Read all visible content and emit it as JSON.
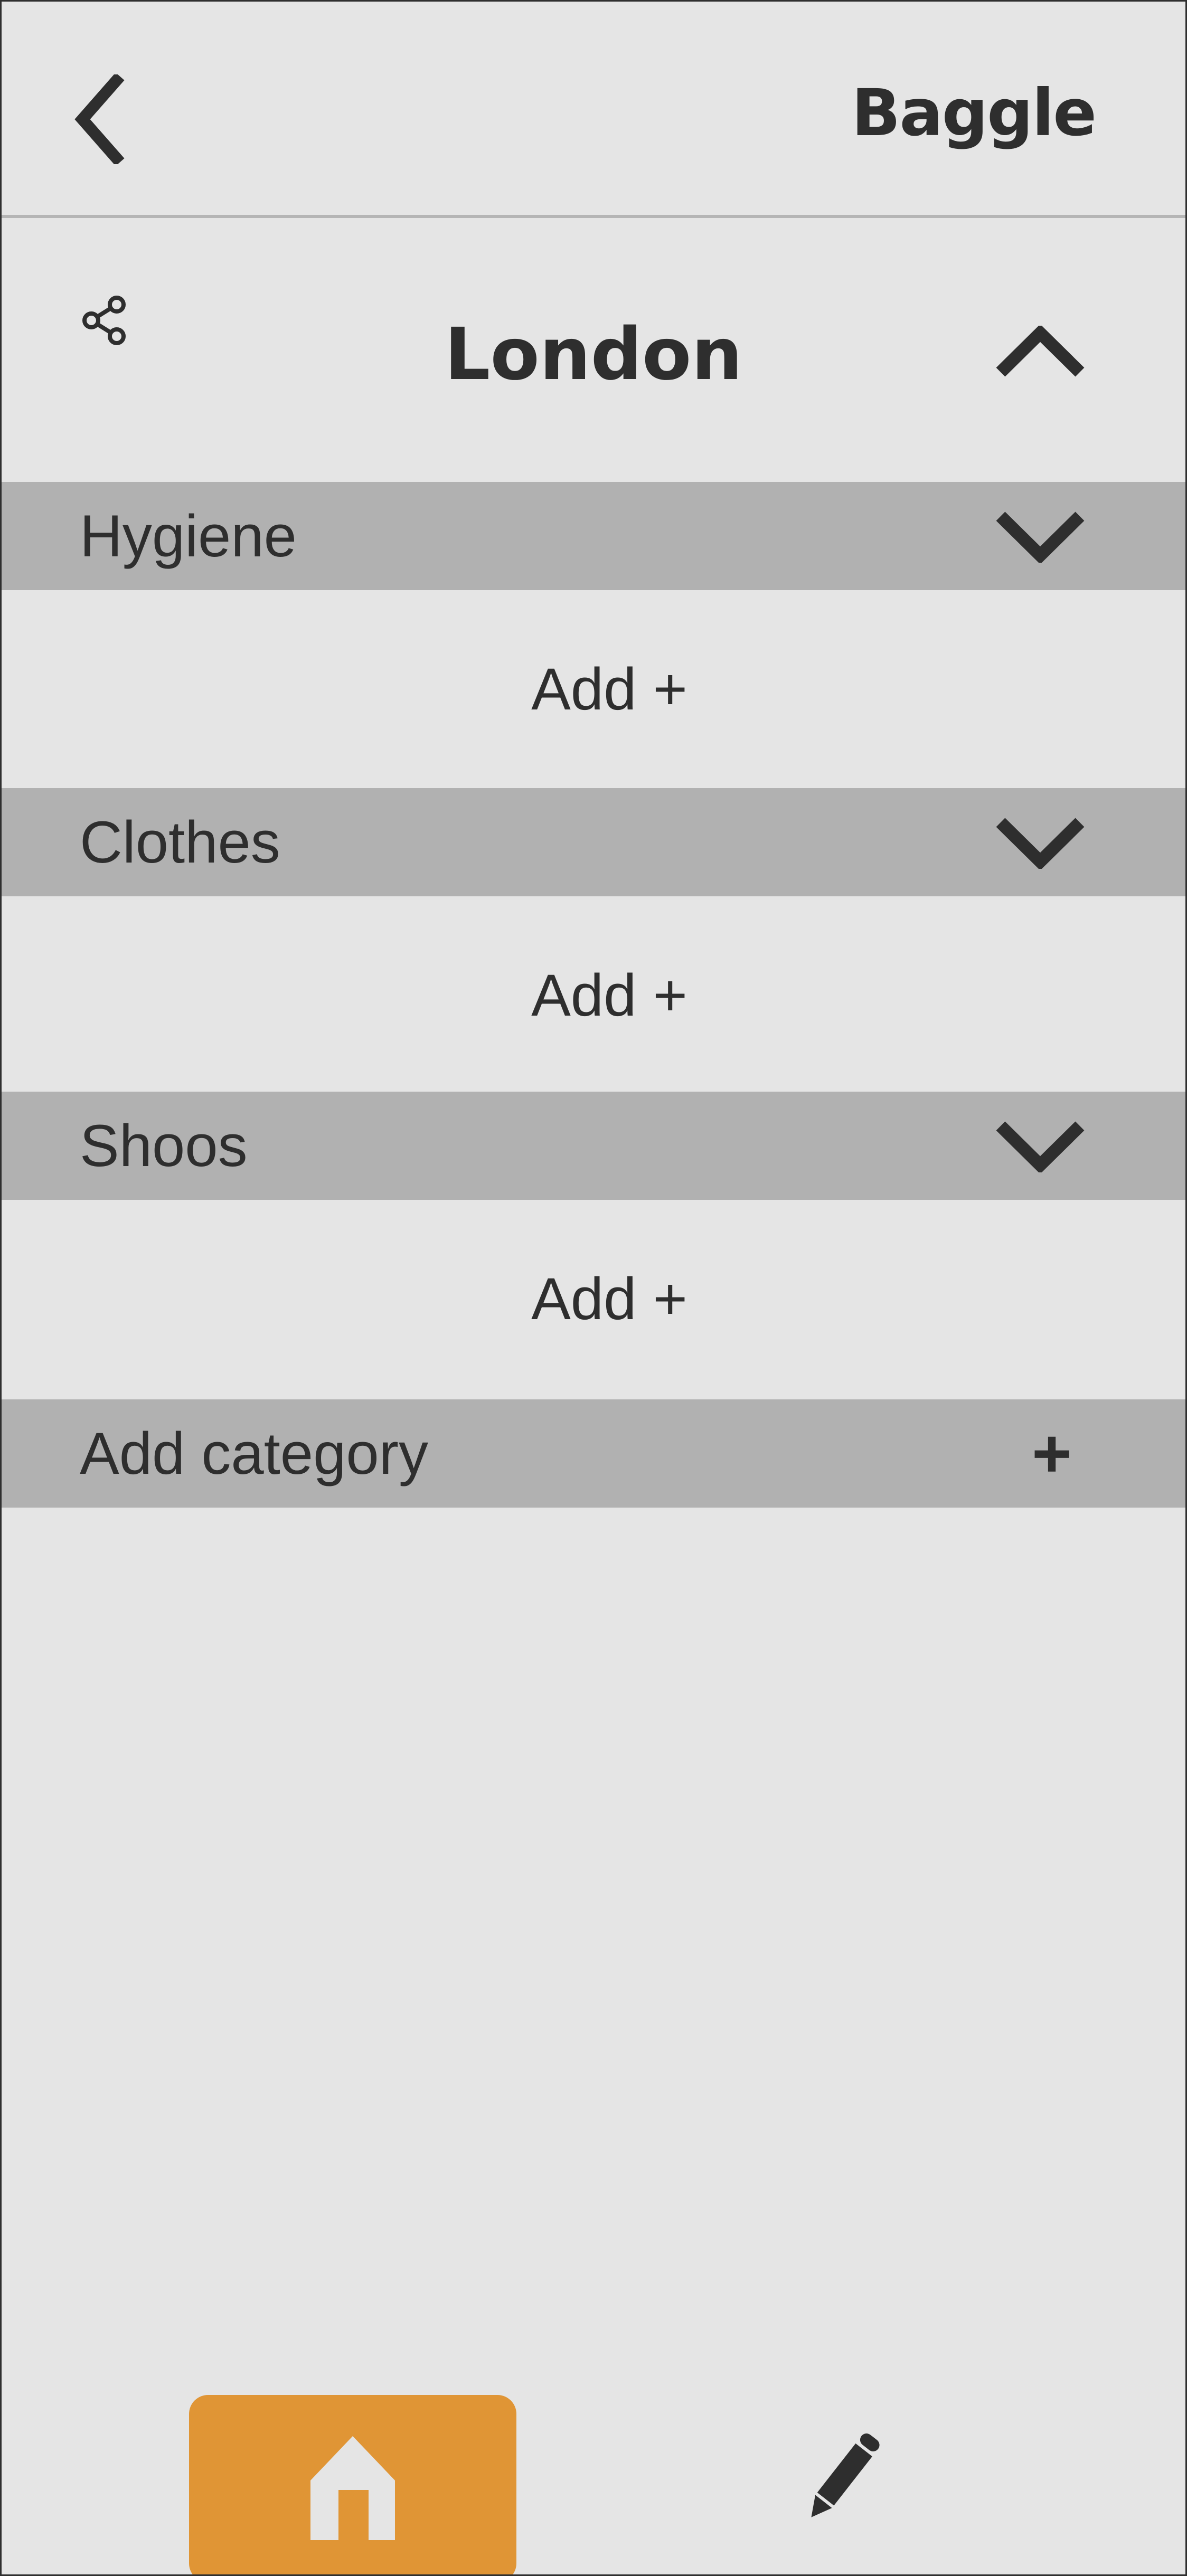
{
  "header": {
    "back_icon": "chevron-left-icon",
    "brand": "Baggle"
  },
  "trip": {
    "share_icon": "share-icon",
    "title": "London",
    "collapse_icon": "chevron-up-icon"
  },
  "categories": [
    {
      "label": "Hygiene",
      "toggle_icon": "chevron-down-icon",
      "add_label": "Add +"
    },
    {
      "label": "Clothes",
      "toggle_icon": "chevron-down-icon",
      "add_label": "Add +"
    },
    {
      "label": "Shoos",
      "toggle_icon": "chevron-down-icon",
      "add_label": "Add +"
    }
  ],
  "add_category": {
    "label": "Add category",
    "plus": "+"
  },
  "bottom_nav": {
    "home_icon": "home-icon",
    "edit_icon": "pencil-icon",
    "active": "home"
  },
  "colors": {
    "background": "#e5e5e5",
    "category_bar": "#b1b1b1",
    "accent": "#e09535",
    "text": "#2e2e2e"
  }
}
